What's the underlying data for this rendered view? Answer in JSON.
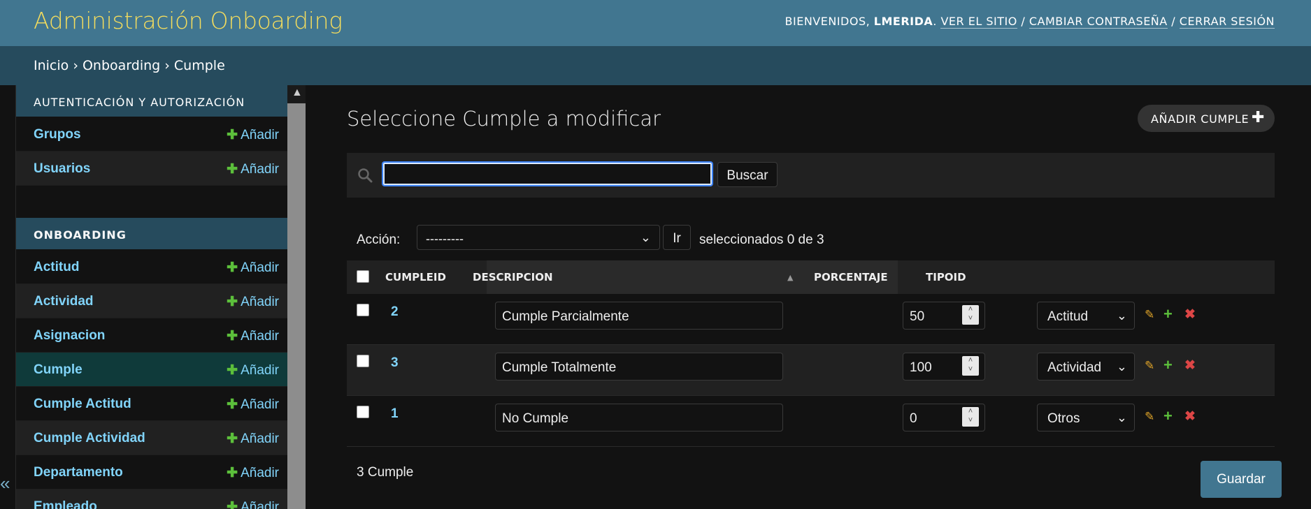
{
  "header": {
    "branding": "Administración Onboarding",
    "welcome": "BIENVENIDOS, ",
    "username": "LMERIDA",
    "period": ". ",
    "view_site": "VER EL SITIO",
    "sep1": " / ",
    "change_password": "CAMBIAR CONTRASEÑA",
    "sep2": " / ",
    "logout": "CERRAR SESIÓN"
  },
  "breadcrumbs": {
    "home": "Inicio",
    "sep": " › ",
    "app": "Onboarding",
    "current": "Cumple"
  },
  "sidebar": {
    "toggle_icon": "«",
    "auth_caption": "AUTENTICACIÓN Y AUTORIZACIÓN",
    "auth_items": [
      {
        "label": "Grupos",
        "add": "Añadir"
      },
      {
        "label": "Usuarios",
        "add": "Añadir"
      }
    ],
    "onb_caption": "ONBOARDING",
    "onb_items": [
      {
        "label": "Actitud",
        "add": "Añadir"
      },
      {
        "label": "Actividad",
        "add": "Añadir"
      },
      {
        "label": "Asignacion",
        "add": "Añadir"
      },
      {
        "label": "Cumple",
        "add": "Añadir"
      },
      {
        "label": "Cumple Actitud",
        "add": "Añadir"
      },
      {
        "label": "Cumple Actividad",
        "add": "Añadir"
      },
      {
        "label": "Departamento",
        "add": "Añadir"
      },
      {
        "label": "Empleado",
        "add": "Añadir"
      }
    ]
  },
  "main": {
    "title": "Seleccione Cumple a modificar",
    "add_button": "AÑADIR CUMPLE",
    "search": {
      "value": "",
      "button": "Buscar"
    },
    "actions": {
      "label": "Acción:",
      "selected": "---------",
      "go": "Ir",
      "counter": "seleccionados 0 de 3"
    },
    "table": {
      "headers": [
        "CUMPLEID",
        "DESCRIPCION",
        "PORCENTAJE",
        "TIPOID"
      ],
      "rows": [
        {
          "id": "2",
          "descripcion": "Cumple Parcialmente",
          "porcentaje": "50",
          "tipo": "Actitud"
        },
        {
          "id": "3",
          "descripcion": "Cumple Totalmente",
          "porcentaje": "100",
          "tipo": "Actividad"
        },
        {
          "id": "1",
          "descripcion": "No Cumple",
          "porcentaje": "0",
          "tipo": "Otros"
        }
      ]
    },
    "result_count": "3 Cumple",
    "save": "Guardar"
  },
  "colors": {
    "header_bg": "#417690",
    "branding": "#f5dd5d",
    "breadcrumbs_bg": "#264b5d",
    "link": "#81d4fa",
    "add_green": "#5cbf3b",
    "delete_red": "#dd4646",
    "edit_yellow": "#e0a428"
  }
}
